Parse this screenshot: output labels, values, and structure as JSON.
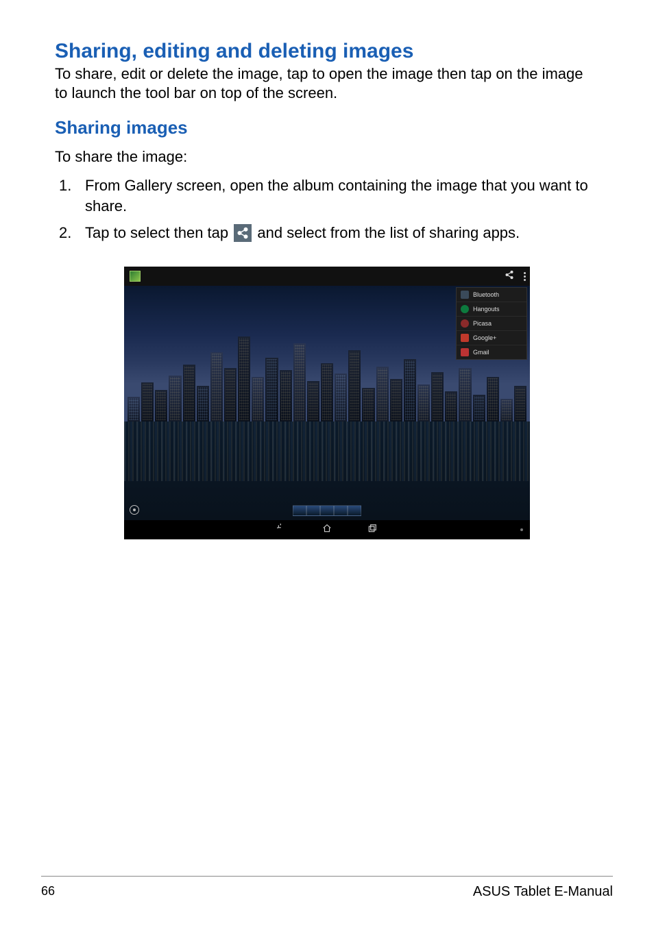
{
  "headings": {
    "main": "Sharing, editing and deleting images",
    "sub": "Sharing images"
  },
  "paragraphs": {
    "intro": "To share, edit or delete the image, tap to open the image then tap on the image to launch the tool bar on top of the screen.",
    "share_intro": "To share the image:"
  },
  "steps": [
    {
      "num": "1.",
      "text": "From Gallery screen, open the album containing the image that you want to share."
    },
    {
      "num": "2.",
      "before": "Tap to select then tap ",
      "after": " and select from the list of sharing apps."
    }
  ],
  "share_menu": [
    "Bluetooth",
    "Hangouts",
    "Picasa",
    "Google+",
    "Gmail"
  ],
  "buildings": [
    28,
    44,
    36,
    52,
    64,
    40,
    78,
    60,
    96,
    50,
    72,
    58,
    88,
    46,
    66,
    54,
    80,
    38,
    62,
    48,
    70,
    42,
    56,
    34,
    60,
    30,
    50,
    26,
    40
  ],
  "footer": {
    "page": "66",
    "title": "ASUS Tablet E-Manual"
  }
}
